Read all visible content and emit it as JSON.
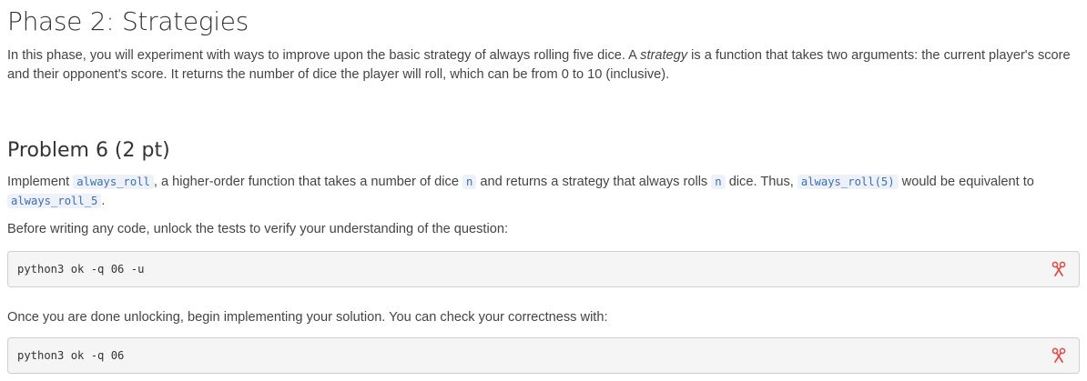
{
  "phase2": {
    "title": "Phase 2: Strategies",
    "intro": {
      "t1": "In this phase, you will experiment with ways to improve upon the basic strategy of always rolling five dice. A ",
      "em": "strategy",
      "t2": " is a function that takes two arguments: the current player's score and their opponent's score. It returns the number of dice the player will roll, which can be from 0 to 10 (inclusive)."
    }
  },
  "problem6": {
    "title": "Problem 6 (2 pt)",
    "desc": {
      "t1": "Implement ",
      "c1": "always_roll",
      "t2": ", a higher-order function that takes a number of dice ",
      "c2": "n",
      "t3": " and returns a strategy that always rolls ",
      "c3": "n",
      "t4": " dice. Thus, ",
      "c4": "always_roll(5)",
      "t5": " would be equivalent to ",
      "c5": "always_roll_5",
      "t6": "."
    },
    "unlock_text": "Before writing any code, unlock the tests to verify your understanding of the question:",
    "unlock_cmd": "python3 ok -q 06 -u",
    "check_text": "Once you are done unlocking, begin implementing your solution. You can check your correctness with:",
    "check_cmd": "python3 ok -q 06"
  },
  "icons": {
    "copy": "scissors-icon",
    "copy_color": "#d9534f"
  }
}
